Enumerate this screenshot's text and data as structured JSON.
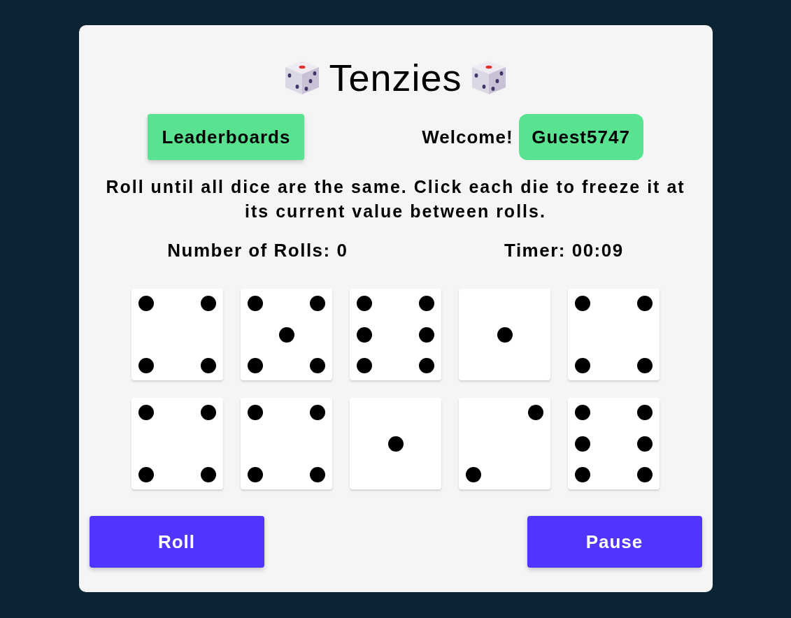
{
  "title": "Tenzies",
  "header": {
    "leaderboards_button": "Leaderboards",
    "welcome": "Welcome!",
    "username": "Guest5747"
  },
  "instructions": "Roll until all dice are the same. Click each die to freeze it at its current value between rolls.",
  "stats": {
    "rolls": "Number of Rolls: 0",
    "timer": "Timer: 00:09"
  },
  "dice": [
    {
      "kind": "four",
      "held": false
    },
    {
      "kind": "five",
      "held": false
    },
    {
      "kind": "six",
      "held": false
    },
    {
      "kind": "one",
      "held": false
    },
    {
      "kind": "four",
      "held": false
    },
    {
      "kind": "four",
      "held": false
    },
    {
      "kind": "four",
      "held": false
    },
    {
      "kind": "one",
      "held": false
    },
    {
      "kind": "two",
      "held": false
    },
    {
      "kind": "six",
      "held": false
    }
  ],
  "buttons": [
    "Roll",
    "Pause"
  ]
}
